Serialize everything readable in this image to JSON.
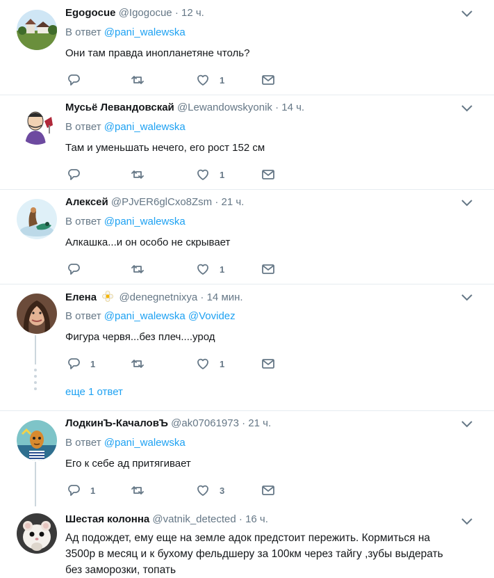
{
  "reply_prefix": "В ответ",
  "more_replies": "еще 1 ответ",
  "tweets": [
    {
      "name": "Egogocue",
      "handle": "@Igogocue",
      "dot": "·",
      "time": "12 ч.",
      "mentions": [
        "@pani_walewska"
      ],
      "text": "Они там правда инопланетяне чтоль?",
      "replies": "",
      "likes": "1"
    },
    {
      "name": "Мусьё Левандовскай",
      "handle": "@Lewandowskyonik",
      "dot": "·",
      "time": "14 ч.",
      "mentions": [
        "@pani_walewska"
      ],
      "text": "Там и уменьшать нечего, его рост 152 см",
      "replies": "",
      "likes": "1"
    },
    {
      "name": "Алексей",
      "handle": "@PJvER6glCxo8Zsm",
      "dot": "·",
      "time": "21 ч.",
      "mentions": [
        "@pani_walewska"
      ],
      "text": "Алкашка...и он особо не скрывает",
      "replies": "",
      "likes": "1"
    },
    {
      "name": "Елена",
      "handle": "@denegnetnixya",
      "dot": "·",
      "time": "14 мин.",
      "mentions": [
        "@pani_walewska",
        "@Vovidez"
      ],
      "text": "Фигура червя...без плеч....урод",
      "replies": "1",
      "likes": "1",
      "emoji": "flower"
    },
    {
      "name": "ЛодкинЪ-КачаловЪ",
      "handle": "@ak07061973",
      "dot": "·",
      "time": "21 ч.",
      "mentions": [
        "@pani_walewska"
      ],
      "text": "Его к себе ад притягивает",
      "replies": "1",
      "likes": "3"
    },
    {
      "name": "Шестая колонна",
      "handle": "@vatnik_detected",
      "dot": "·",
      "time": "16 ч.",
      "mentions": [],
      "text": "Ад подождет, ему еще на земле адок предстоит пережить. Кормиться на 3500р в месяц и к бухому фельдшеру за 100км через тайгу ,зубы выдерать без заморозки, топать",
      "replies": "",
      "likes": ""
    }
  ],
  "colors": {
    "link": "#1da1f2",
    "muted": "#657786",
    "separator": "#e6ecf0",
    "thread": "#ccd6dd"
  }
}
